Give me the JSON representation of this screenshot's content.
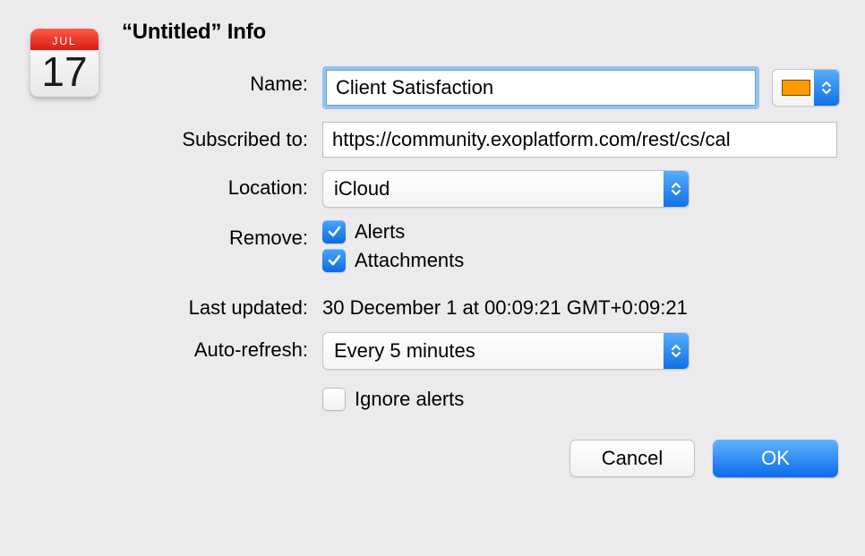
{
  "title": "“Untitled” Info",
  "icon": {
    "month": "JUL",
    "day": "17"
  },
  "labels": {
    "name": "Name:",
    "subscribed": "Subscribed to:",
    "location": "Location:",
    "remove": "Remove:",
    "lastUpdated": "Last updated:",
    "autoRefresh": "Auto-refresh:"
  },
  "fields": {
    "name": "Client Satisfaction",
    "subscribedTo": "https://community.exoplatform.com/rest/cs/cal",
    "location": "iCloud",
    "autoRefresh": "Every 5 minutes",
    "lastUpdated": "30 December 1 at 00:09:21 GMT+0:09:21"
  },
  "remove": {
    "alerts": {
      "label": "Alerts",
      "checked": true
    },
    "attachments": {
      "label": "Attachments",
      "checked": true
    }
  },
  "ignoreAlerts": {
    "label": "Ignore alerts",
    "checked": false
  },
  "colorSwatch": "#ff9b00",
  "buttons": {
    "cancel": "Cancel",
    "ok": "OK"
  }
}
